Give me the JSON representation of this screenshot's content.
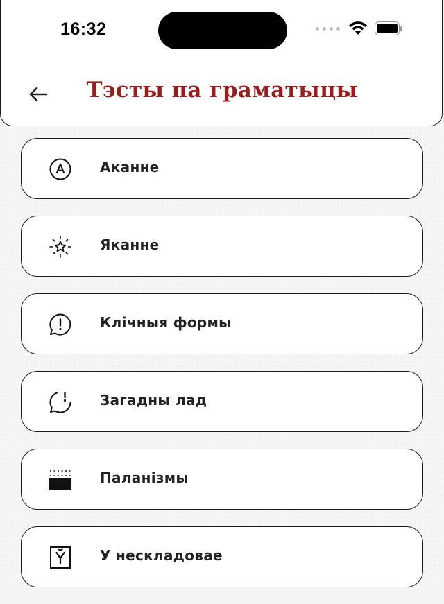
{
  "status_bar": {
    "time": "16:32"
  },
  "header": {
    "title": "Тэсты па граматыцы",
    "title_color": "#9a1c1c",
    "back_icon": "arrow-left-icon"
  },
  "items": [
    {
      "label": "Аканне",
      "icon": "letter-a-circle-icon"
    },
    {
      "label": "Яканне",
      "icon": "sparkle-star-icon"
    },
    {
      "label": "Клічныя формы",
      "icon": "speech-bubble-exclamation-icon"
    },
    {
      "label": "Загадны лад",
      "icon": "speech-bubble-partial-icon"
    },
    {
      "label": "Паланізмы",
      "icon": "dotted-block-icon"
    },
    {
      "label": "У нескладовае",
      "icon": "letter-u-short-box-icon"
    }
  ]
}
